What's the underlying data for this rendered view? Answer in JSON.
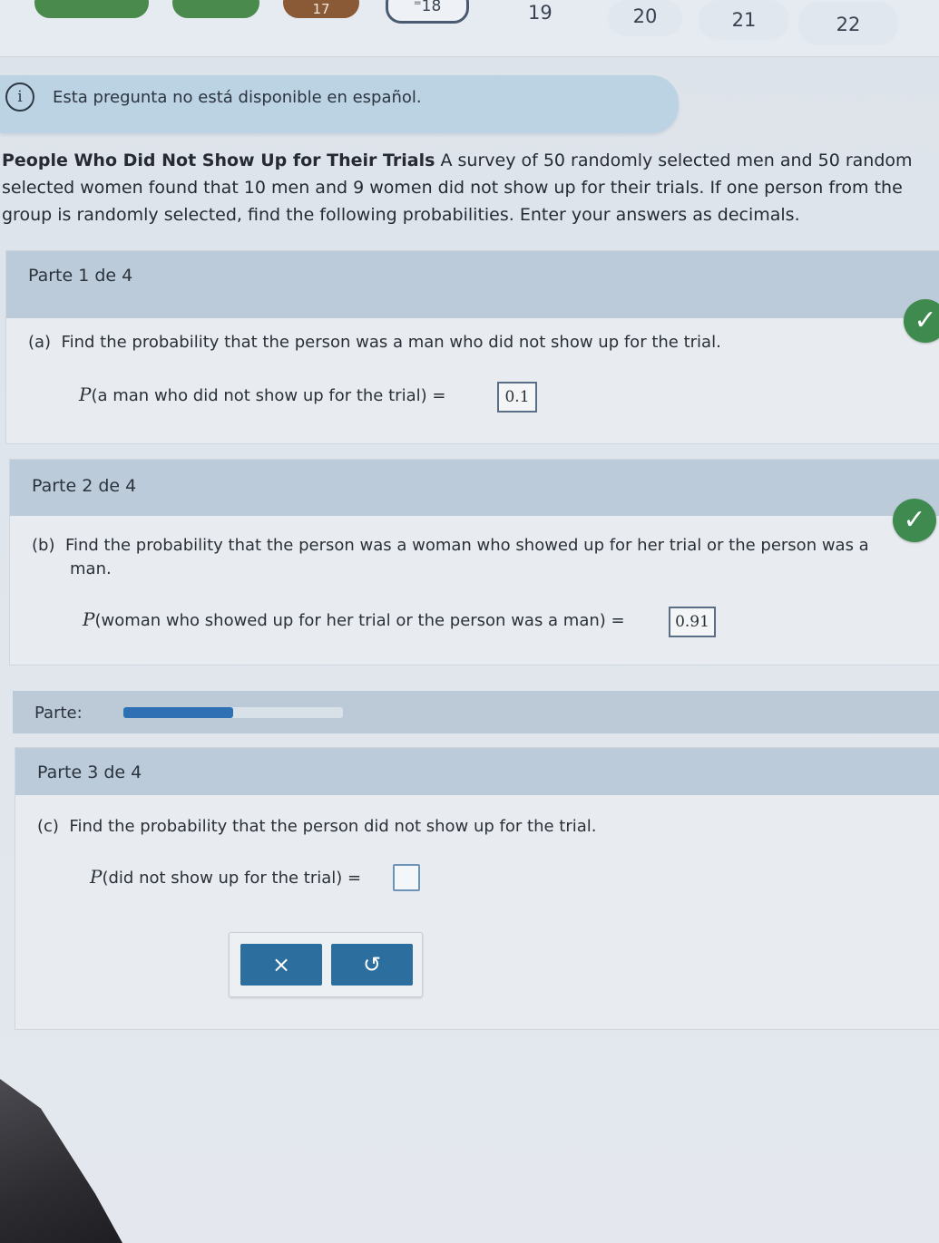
{
  "nav": {
    "current_label": "18",
    "current_prefix": "⁼",
    "brown_label": "17",
    "numbers": [
      "19",
      "20",
      "21",
      "22"
    ]
  },
  "banner": {
    "icon": "info-icon",
    "text": "Esta pregunta no está disponible en español."
  },
  "problem": {
    "title": "People Who Did Not Show Up for Their Trials",
    "line1": " A survey of 50 randomly selected men and 50 random",
    "line2": "selected women found that 10 men and 9 women did not show up for their trials. If one person from the",
    "line3": "group is randomly selected, find the following probabilities. Enter your answers as decimals."
  },
  "part1": {
    "title": "Parte 1 de 4",
    "letter": "(a)",
    "question": "Find the probability that the person was a man who did not show up for the trial.",
    "eq_P": "P",
    "eq_text": "(a man who did not show up for the trial) =",
    "answer": "0.1",
    "status_icon": "check-icon"
  },
  "part2": {
    "title": "Parte 2 de 4",
    "letter": "(b)",
    "question_line1": "Find the probability that the person was a woman who showed up for her trial or the person was a",
    "question_line2": "man.",
    "eq_P": "P",
    "eq_text": "(woman who showed up for her trial or the person was a man) =",
    "answer": "0.91",
    "status_icon": "check-icon"
  },
  "progress": {
    "label": "Parte:",
    "fraction": 0.5,
    "fill_color": "#2f6fb3"
  },
  "part3": {
    "title": "Parte 3 de 4",
    "letter": "(c)",
    "question": "Find the probability that the person did not show up for the trial.",
    "eq_P": "P",
    "eq_text": "(did not show up for the trial) ="
  },
  "actions": {
    "clear_label": "×",
    "undo_label": "↺"
  },
  "colors": {
    "accent": "#2c6f9e",
    "check": "#3f8a4f",
    "header": "#bccbd9"
  }
}
